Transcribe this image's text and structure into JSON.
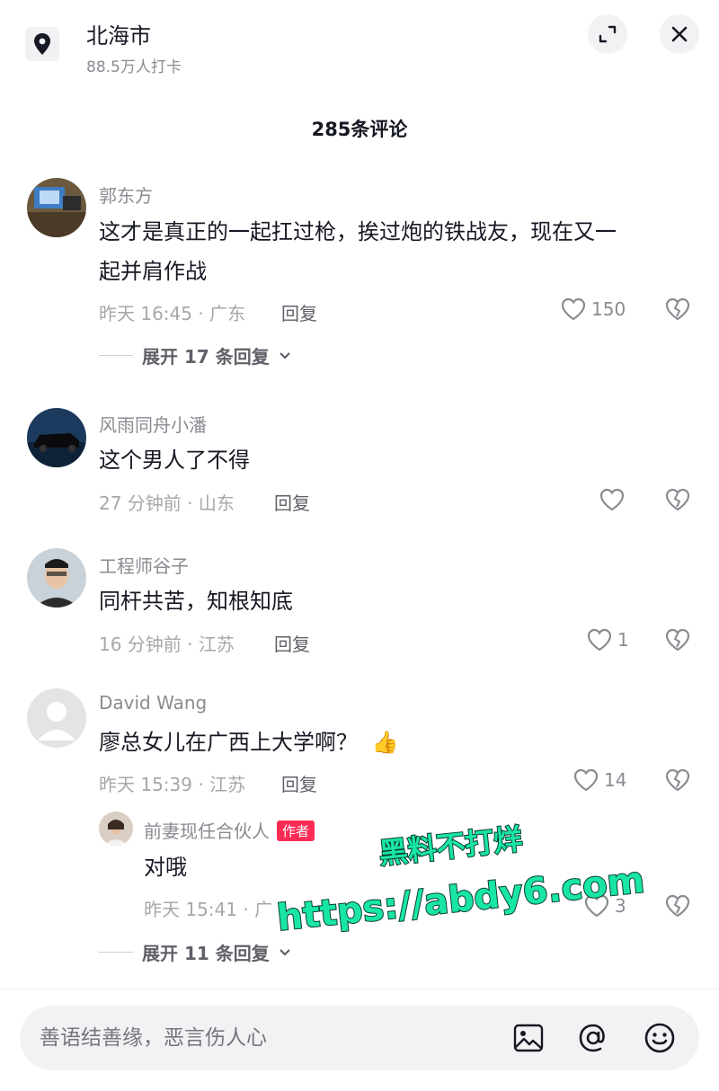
{
  "location": {
    "title": "北海市",
    "subtitle": "88.5万人打卡"
  },
  "comment_count": "285条评论",
  "comments": [
    {
      "user": "郭东方",
      "text_line1": "这才是真正的一起扛过枪，挨过炮的铁战友，现在又一",
      "text_line2": "起并肩作战",
      "meta": "昨天 16:45 · 广东",
      "reply": "回复",
      "likes": "150",
      "expand": "展开 17 条回复"
    },
    {
      "user": "风雨同舟小潘",
      "text_line1": "这个男人了不得",
      "meta": "27 分钟前 · 山东",
      "reply": "回复",
      "likes": ""
    },
    {
      "user": "工程师谷子",
      "text_line1": "同杆共苦，知根知底",
      "meta": "16 分钟前 · 江苏",
      "reply": "回复",
      "likes": "1"
    },
    {
      "user": "David Wang",
      "text_line1": "廖总女儿在广西上大学啊？",
      "emoji": "👍",
      "meta": "昨天 15:39 · 江苏",
      "reply": "回复",
      "likes": "14",
      "sub_reply": {
        "user": "前妻现任合伙人",
        "tag": "作者",
        "text": "对哦",
        "meta": "昨天 15:41 · 广",
        "likes": "3"
      },
      "expand": "展开 11 条回复"
    }
  ],
  "watermark": {
    "line1": "黑料不打烊",
    "line2": "https://abdy6.com"
  },
  "input": {
    "placeholder": "善语结善缘，恶言伤人心"
  },
  "icons": [
    "location-pin-icon",
    "expand-icon",
    "close-icon",
    "heart-icon",
    "broken-heart-icon",
    "chevron-down-icon",
    "image-icon",
    "at-icon",
    "emoji-icon"
  ],
  "colors": {
    "author_tag": "#fe2c55",
    "watermark_fill": "#19e6a6"
  }
}
